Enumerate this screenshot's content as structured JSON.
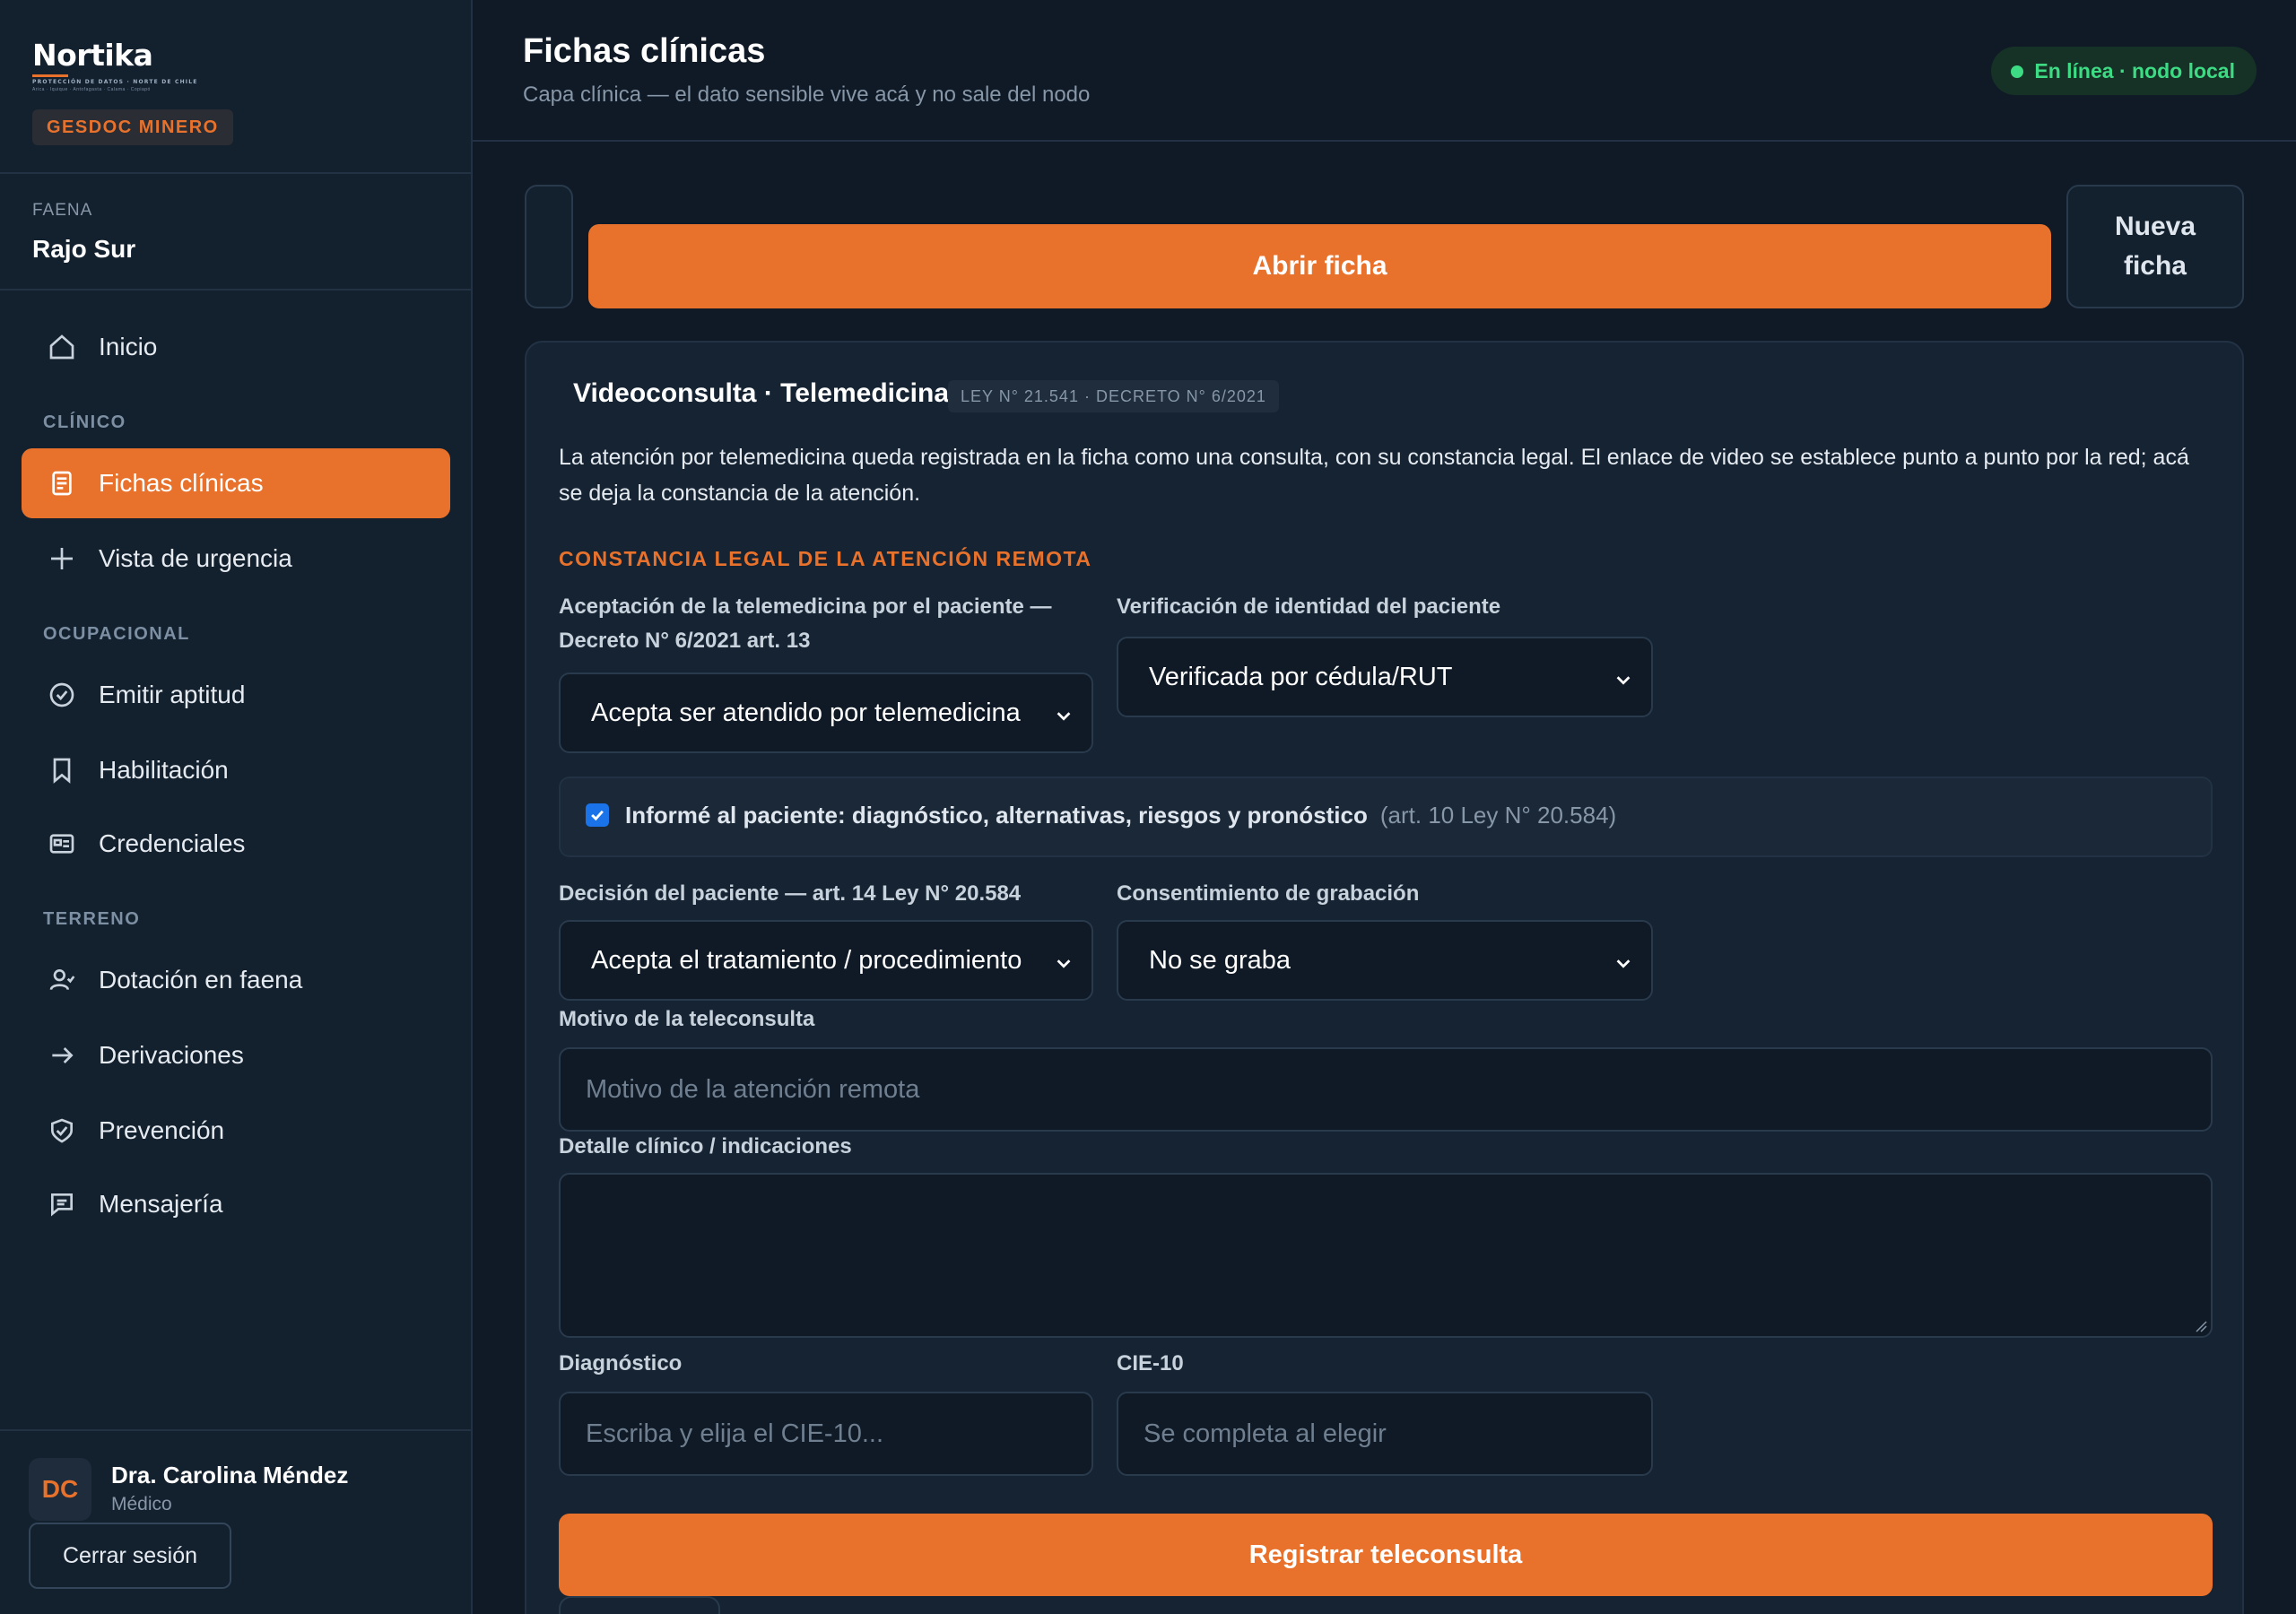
{
  "brand": {
    "logo": "Nortika",
    "tagline": "PROTECCIÓN DE DATOS · NORTE DE CHILE",
    "subline": "Arica · Iquique · Antofagasta · Calama · Copiapó",
    "badge": "GESDOC MINERO"
  },
  "faena": {
    "label": "FAENA",
    "value": "Rajo Sur"
  },
  "sidebar": {
    "inicio": "Inicio",
    "section_clinico": "CLÍNICO",
    "fichas": "Fichas clínicas",
    "urgencia": "Vista de urgencia",
    "section_ocupacional": "OCUPACIONAL",
    "aptitud": "Emitir aptitud",
    "habilitacion": "Habilitación",
    "credenciales": "Credenciales",
    "section_terreno": "TERRENO",
    "dotacion": "Dotación en faena",
    "derivaciones": "Derivaciones",
    "prevencion": "Prevención",
    "mensajeria": "Mensajería"
  },
  "user": {
    "initials": "DC",
    "name": "Dra. Carolina Méndez",
    "role": "Médico",
    "logout": "Cerrar sesión"
  },
  "header": {
    "title": "Fichas clínicas",
    "subtitle": "Capa clínica — el dato sensible vive acá y no sale del nodo",
    "status": "En línea · nodo local",
    "status_color": "#3ddc84"
  },
  "toolbar": {
    "open": "Abrir ficha",
    "new_line1": "Nueva",
    "new_line2": "ficha"
  },
  "card": {
    "title": "Videoconsulta · Telemedicina",
    "law_badge": "LEY N° 21.541 · DECRETO N° 6/2021",
    "description": "La atención por telemedicina queda registrada en la ficha como una consulta, con su constancia legal. El enlace de video se establece punto a punto por la red; acá se deja la constancia de la atención.",
    "section": "CONSTANCIA LEGAL DE LA ATENCIÓN REMOTA",
    "acceptance_label_1": "Aceptación de la telemedicina por el paciente —",
    "acceptance_label_2": "Decreto N° 6/2021 art. 13",
    "acceptance_value": "Acepta ser atendido por telemedicina",
    "identity_label": "Verificación de identidad del paciente",
    "identity_value": "Verificada por cédula/RUT",
    "informed_text": "Informé al paciente: diagnóstico, alternativas, riesgos y pronóstico",
    "informed_note": "(art. 10 Ley N° 20.584)",
    "informed_checked": true,
    "decision_label": "Decisión del paciente — art. 14 Ley N° 20.584",
    "decision_value": "Acepta el tratamiento / procedimiento",
    "recording_label": "Consentimiento de grabación",
    "recording_value": "No se graba",
    "motivo_label": "Motivo de la teleconsulta",
    "motivo_placeholder": "Motivo de la atención remota",
    "detalle_label": "Detalle clínico / indicaciones",
    "diagnostico_label": "Diagnóstico",
    "diagnostico_placeholder": "Escriba y elija el CIE-10...",
    "cie_label": "CIE-10",
    "cie_placeholder": "Se completa al elegir",
    "submit": "Registrar teleconsulta"
  },
  "colors": {
    "accent": "#e8722c",
    "background": "#0f1a26",
    "panel": "#13202e"
  }
}
